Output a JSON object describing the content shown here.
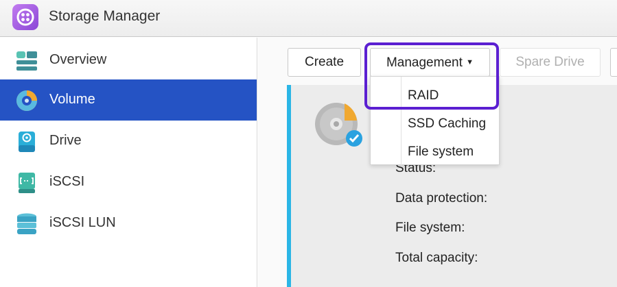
{
  "app": {
    "title": "Storage Manager",
    "icon": "storage-manager-icon"
  },
  "sidebar": {
    "items": [
      {
        "label": "Overview",
        "icon": "overview-icon",
        "active": false
      },
      {
        "label": "Volume",
        "icon": "volume-icon",
        "active": true
      },
      {
        "label": "Drive",
        "icon": "drive-icon",
        "active": false
      },
      {
        "label": "iSCSI",
        "icon": "iscsi-icon",
        "active": false
      },
      {
        "label": "iSCSI LUN",
        "icon": "iscsi-lun-icon",
        "active": false
      }
    ]
  },
  "toolbar": {
    "create_label": "Create",
    "management_label": "Management",
    "spare_drive_label": "Spare Drive"
  },
  "management_menu": {
    "items": [
      "RAID",
      "SSD Caching",
      "File system"
    ]
  },
  "volume_details": {
    "status_label": "Status:",
    "data_protection_label": "Data protection:",
    "file_system_label": "File system:",
    "total_capacity_label": "Total capacity:"
  },
  "colors": {
    "accent": "#2553c4",
    "highlight": "#5b1fd1",
    "volume_bar": "#2bb6e6"
  }
}
